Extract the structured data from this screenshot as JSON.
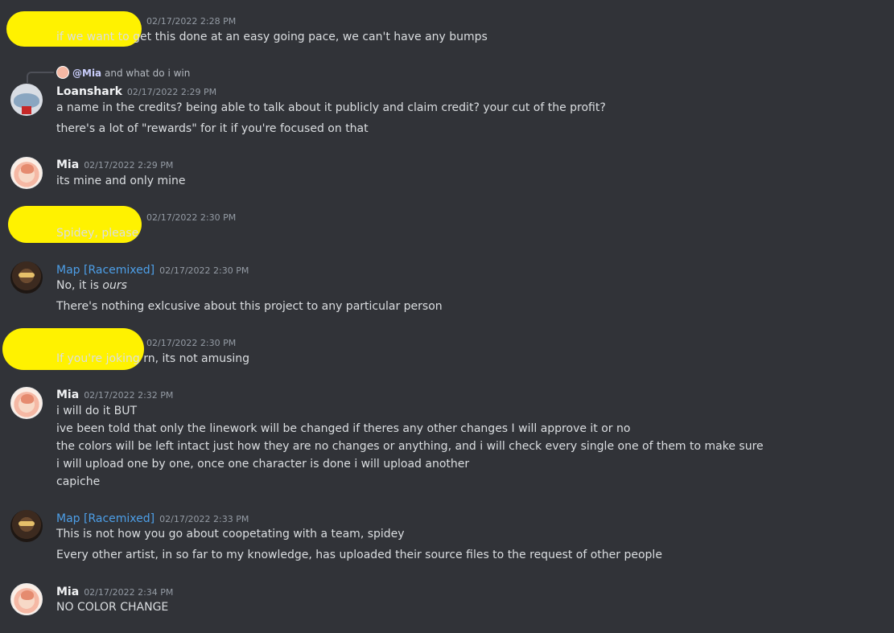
{
  "messages": [
    {
      "id": "m1",
      "timestamp": "02/17/2022 2:28 PM",
      "lines": [
        "if we want to get this done at an easy going pace, we can't have any bumps"
      ]
    },
    {
      "id": "m2",
      "reply": {
        "mention": "@Mia",
        "text": "and what do i win"
      },
      "username": "Loanshark",
      "timestamp": "02/17/2022 2:29 PM",
      "lines": [
        "a name in the credits? being able to talk about it publicly and claim credit? your cut of the profit?",
        "there's a lot of \"rewards\" for it if you're focused on that"
      ]
    },
    {
      "id": "m3",
      "username": "Mia",
      "timestamp": "02/17/2022 2:29 PM",
      "lines": [
        "its mine and only mine"
      ]
    },
    {
      "id": "m4",
      "timestamp": "02/17/2022 2:30 PM",
      "lines": [
        "Spidey, please"
      ]
    },
    {
      "id": "m5",
      "username": "Map [Racemixed]",
      "timestamp": "02/17/2022 2:30 PM",
      "lines": [
        "No, it is ",
        "ours",
        "There's nothing exlcusive about this project to any particular person"
      ]
    },
    {
      "id": "m6",
      "timestamp": "02/17/2022 2:30 PM",
      "lines": [
        "If you're joking rn, its not amusing"
      ]
    },
    {
      "id": "m7",
      "username": "Mia",
      "timestamp": "02/17/2022 2:32 PM",
      "lines": [
        "i will do it BUT",
        "ive been told that only the linework will be changed if theres any other changes I will approve it or no",
        "the colors will be left intact just how they are no changes or anything, and  i will check every single one of them to make sure",
        "i will upload one by one, once one character is done i will upload another",
        "capiche"
      ]
    },
    {
      "id": "m8",
      "username": "Map [Racemixed]",
      "timestamp": "02/17/2022 2:33 PM",
      "lines": [
        "This is not how you go about coopetating with a team, spidey",
        "Every other artist, in so far to my knowledge, has uploaded their source files to the request of other people"
      ]
    },
    {
      "id": "m9",
      "username": "Mia",
      "timestamp": "02/17/2022 2:34 PM",
      "lines": [
        "NO COLOR CHANGE"
      ]
    }
  ],
  "colors": {
    "background": "#313338",
    "text": "#dbdee1",
    "timestamp": "#949ba4",
    "role_blue": "#4d9fe8",
    "redaction": "#fff200"
  },
  "icons": {
    "mia_avatar": "mia-avatar",
    "loanshark_avatar": "loanshark-avatar",
    "map_avatar": "map-avatar"
  }
}
